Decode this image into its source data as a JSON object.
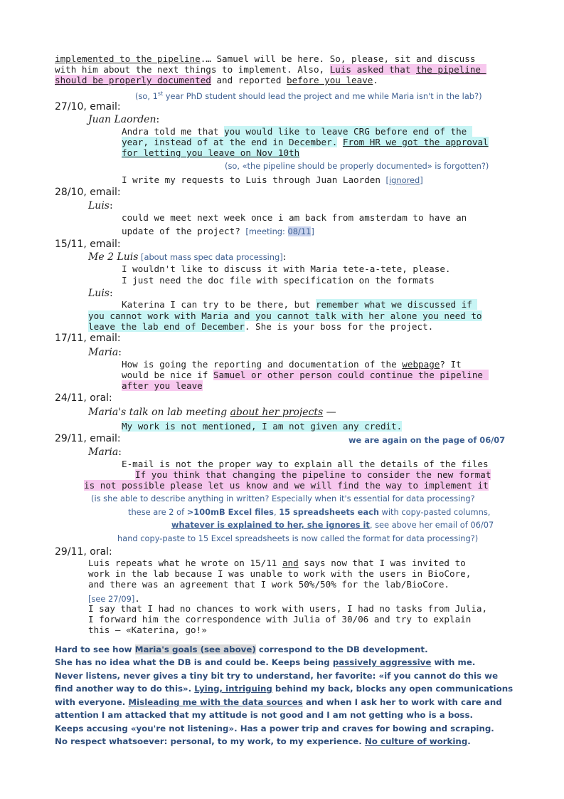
{
  "p1": {
    "l1a": "implemented to the pipeline",
    "l1b": ".… Samuel will be here. So, please, sit and discuss",
    "l2": "with him about the next things to implement. Also, ",
    "l2b": "Luis asked that ",
    "l2c": "the pipeline ",
    "l3a": "should be properly documented",
    "l3b": " and reported ",
    "l3c": "before you leave",
    "l3d": ".",
    "note_a": "(so, 1",
    "note_sup": "st",
    "note_b": " year PhD student should lead the project and me while Maria isn't in the lab?)"
  },
  "e2710": {
    "head": "27/10, email:",
    "speaker": "Juan Laorden",
    "colon": ":",
    "l1a": "Andra told me that ",
    "l1b": "you would like to leave CRG before end of the ",
    "l2a": "year, instead of at the end in December.",
    "l2b": " ",
    "l2c": "From HR we got the approval",
    "l3": "for letting you leave on Nov 10th",
    "note": "(so, «the pipeline should be properly documented» is forgotten?)",
    "l4": "I write my requests to Luis through Juan Laorden ",
    "l4note_a": "[",
    "l4note_b": "ignored",
    "l4note_c": "]"
  },
  "e2810": {
    "head": "28/10, email:",
    "speaker": "Luis",
    "colon": ":",
    "l1": "could we meet next week once i am back from amsterdam to have an",
    "l2": "update of the project? ",
    "l2note_a": "[meeting: ",
    "l2note_b": "08/11",
    "l2note_c": "]"
  },
  "e1511": {
    "head": "15/11, email:",
    "speaker1": "Me 2 Luis",
    "speaker1_note": " [about mass spec data processing]",
    "colon": ":",
    "l1": "I wouldn't like to discuss it with Maria tete-a-tete, please.",
    "l2": "I just need the doc file with specification on the formats",
    "speaker2": "Luis",
    "l3a": "Katerina I can try to be there, but ",
    "l3b": "remember what we discussed if ",
    "l4": "you cannot work with Maria and you cannot talk with her alone you need to",
    "l5a": "leave the lab end of December",
    "l5b": ". She is your boss for the project."
  },
  "e1711": {
    "head": "17/11, email:",
    "speaker": "Maria",
    "colon": ":",
    "l1a": "How is going the reporting and documentation of the ",
    "l1b": "webpage",
    "l1c": "? It",
    "l2a": "would be nice if ",
    "l2b": "Samuel or other person could continue the pipeline ",
    "l3": "after you leave"
  },
  "o2411": {
    "head": "24/11, oral:",
    "talk_a": "Maria's talk on lab meeting ",
    "talk_b": "about her projects",
    "talk_c": " —",
    "l1": "My work is not mentioned, I am not given any credit."
  },
  "e2911": {
    "head": "29/11, email:",
    "right_note": "we are again on the page of 06/07",
    "speaker": "Maria",
    "colon": ":",
    "l1": "E-mail is not the proper way to explain all the details of the files",
    "l2": "If you think that changing the pipeline to consider the new format",
    "l3": "is not possible please let us know and we will find the way to implement it",
    "n1": "(is she able to describe anything in written? Especially when it's essential for data processing?",
    "n2a": "these are 2 of ",
    "n2b": ">100mB Excel files",
    "n2c": ", ",
    "n2d": "15 spreadsheets each",
    "n2e": " with copy-pasted columns,",
    "n3a": "whatever is explained to her, she ignores it",
    "n3b": ", see above her email of 06/07",
    "n4": "hand copy-paste to 15 Excel spreadsheets is now called the format for data processing?)"
  },
  "o2911": {
    "head": "29/11, oral:",
    "l1a": "Luis repeats what he wrote on 15/11 ",
    "l1b": "and",
    "l1c": " says now that I was invited to",
    "l2": "work in the lab because I was unable to work with the users in BioCore,",
    "l3": "and there was an agreement that I work 50%/50% for the lab/BioCore.",
    "note": "[see 27/09]",
    "note_dot": ".",
    "l4": "I say that I had no chances to work with users, I had no tasks from Julia,",
    "l5": "I forward him the correspondence with Julia of 30/06 and try to explain",
    "l6": "this — «Katerina, go!»"
  },
  "summary": {
    "l1a": "Hard to see how ",
    "l1b": "Maria's goals (see above)",
    "l1c": " correspond to the DB development.",
    "l2a": "She has no idea what the DB is and could be. Keeps being ",
    "l2b": "passively aggressive",
    "l2c": " with me.",
    "l3": "Never listens, never gives a tiny bit try to understand, her favorite: «if you cannot do this we",
    "l4a": "find another way to do this». ",
    "l4b": "Lying, intriguing",
    "l4c": " behind my back, blocks any open communications",
    "l5a": "with everyone. ",
    "l5b": "Misleading me with the data sources",
    "l5c": " and when I ask her to work with care and",
    "l6": "attention I am attacked that my attitude is not good and I am not getting who is a boss.",
    "l7": "Keeps accusing «you're not listening». Has a power trip and craves for bowing and scraping.",
    "l8a": "No respect whatsoever: personal, to my work, to my experience. ",
    "l8b": "No culture of working",
    "l8c": "."
  }
}
